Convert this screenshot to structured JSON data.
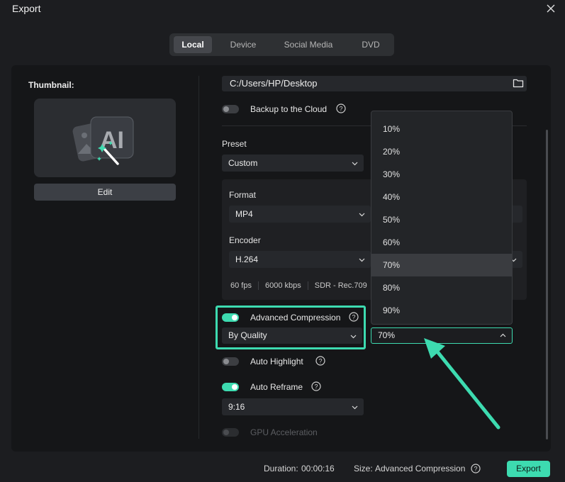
{
  "window": {
    "title": "Export"
  },
  "tabs": [
    {
      "label": "Local",
      "active": true
    },
    {
      "label": "Device",
      "active": false
    },
    {
      "label": "Social Media",
      "active": false
    },
    {
      "label": "DVD",
      "active": false
    }
  ],
  "thumbnail": {
    "label": "Thumbnail:",
    "edit_label": "Edit"
  },
  "save_path": {
    "value": "C:/Users/HP/Desktop"
  },
  "backup": {
    "label": "Backup to the Cloud",
    "enabled": false
  },
  "preset": {
    "label": "Preset",
    "value": "Custom"
  },
  "format": {
    "label": "Format",
    "value": "MP4"
  },
  "encoder": {
    "label": "Encoder",
    "value": "H.264"
  },
  "info": {
    "fps": "60 fps",
    "bitrate": "6000 kbps",
    "color": "SDR - Rec.709"
  },
  "advanced_compression": {
    "label": "Advanced Compression",
    "enabled": true,
    "mode": "By Quality",
    "quality": "70%"
  },
  "quality_options": [
    "10%",
    "20%",
    "30%",
    "40%",
    "50%",
    "60%",
    "70%",
    "80%",
    "90%"
  ],
  "selected_quality": "70%",
  "auto_highlight": {
    "label": "Auto Highlight",
    "enabled": false
  },
  "auto_reframe": {
    "label": "Auto Reframe",
    "enabled": true,
    "ratio": "9:16"
  },
  "gpu": {
    "label": "GPU Acceleration",
    "enabled": false,
    "disabled": true
  },
  "footer": {
    "duration_label": "Duration:",
    "duration_value": "00:00:16",
    "size_label": "Size:",
    "size_value": "Advanced Compression",
    "export_label": "Export"
  },
  "colors": {
    "accent": "#3ddbb0",
    "background": "#1c1d20",
    "panel": "#151618"
  }
}
